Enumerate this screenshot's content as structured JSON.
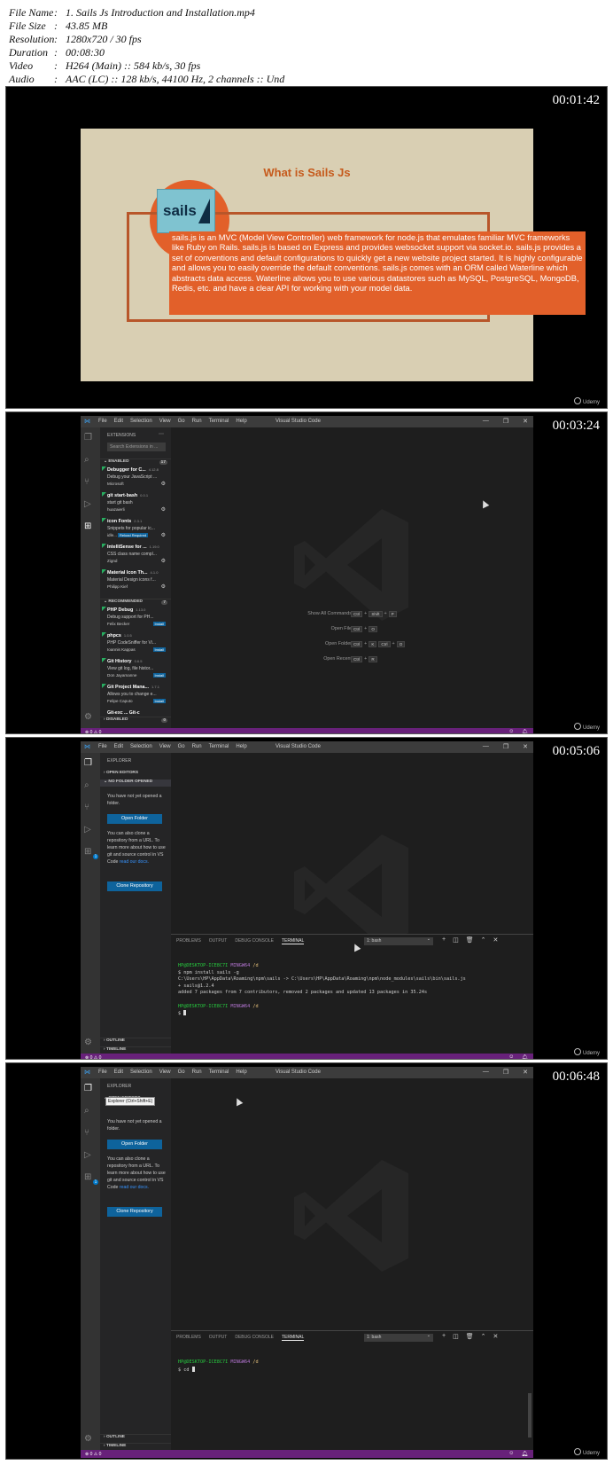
{
  "meta": [
    {
      "key": "File Name",
      "colon": ":",
      "value": "1. Sails Js Introduction and Installation.mp4"
    },
    {
      "key": "File Size",
      "colon": ":",
      "value": "43.85 MB"
    },
    {
      "key": "Resolution",
      "colon": ":",
      "value": "1280x720 / 30 fps"
    },
    {
      "key": "Duration",
      "colon": ":",
      "value": "00:08:30"
    },
    {
      "key": "Video",
      "colon": ":",
      "value": "H264 (Main) :: 584 kb/s, 30 fps"
    },
    {
      "key": "Audio",
      "colon": ":",
      "value": "AAC (LC) :: 128 kb/s, 44100 Hz, 2 channels :: Und"
    }
  ],
  "watermark": "Udemy",
  "frame1": {
    "timestamp": "00:01:42",
    "slide_title": "What is Sails Js",
    "logo_text": "sails",
    "slide_text": "sails.js is an MVC (Model View Controller) web framework for node.js that emulates familiar MVC frameworks like Ruby on Rails. sails.js is based on Express and provides websocket support via socket.io. sails.js provides a set of conventions and default configurations to quickly get a new website project started. It is highly configurable and allows you to easily override the default conventions. sails.js comes with an ORM called Waterline which abstracts data access. Waterline allows you to use various datastores such as MySQL, PostgreSQL, MongoDB, Redis, etc. and have a clear API for working with your model data."
  },
  "vscode": {
    "menu": [
      "File",
      "Edit",
      "Selection",
      "View",
      "Go",
      "Run",
      "Terminal",
      "Help"
    ],
    "title": "Visual Studio Code",
    "status_left": "⊗ 0 ⚠ 0"
  },
  "frame2": {
    "timestamp": "00:03:24",
    "sidebar_title": "EXTENSIONS",
    "search_placeholder": "Search Extensions in ...",
    "enabled_label": "ENABLED",
    "enabled_count": "17",
    "enabled": [
      {
        "name": "Debugger for C...",
        "version": "4.12.8",
        "desc": "Debug your JavaScript ...",
        "author": "Microsoft"
      },
      {
        "name": "git start-bash",
        "version": "0.0.1",
        "desc": "start git bash",
        "author": "huazaierli"
      },
      {
        "name": "icon Fonts",
        "version": "2.3.1",
        "desc": "Snippets for popular ic...",
        "author": "idle...",
        "badge": "Reload Required"
      },
      {
        "name": "IntelliSense for ...",
        "version": "1.19.0",
        "desc": "CSS class name compl...",
        "author": "Zignd"
      },
      {
        "name": "Material Icon Th...",
        "version": "4.1.0",
        "desc": "Material Design icons f...",
        "author": "Philipp Kief"
      }
    ],
    "recommended_label": "RECOMMENDED",
    "recommended_count": "7",
    "recommended": [
      {
        "name": "PHP Debug",
        "version": "1.13.0",
        "desc": "Debug support for PH...",
        "author": "Felix Becker",
        "install": "Install"
      },
      {
        "name": "phpcs",
        "version": "1.0.5",
        "desc": "PHP CodeSniffer for Vi...",
        "author": "Ioannis Kappas",
        "install": "Install"
      },
      {
        "name": "Git History",
        "version": "0.6.5",
        "desc": "View git log, file histor...",
        "author": "Don Jayamanne",
        "install": "Install"
      },
      {
        "name": "Git Project Mana...",
        "version": "1.7.1",
        "desc": "Allows you to change e...",
        "author": "Felipe Caputo",
        "install": "Install"
      }
    ],
    "cut_item": "Git-exc ... Git-c",
    "disabled_label": "DISABLED",
    "disabled_count": "0",
    "shortcuts": [
      {
        "label": "Show All Commands",
        "keys": [
          "Ctrl",
          "+",
          "Shift",
          "+",
          "P"
        ]
      },
      {
        "label": "Open File",
        "keys": [
          "Ctrl",
          "+",
          "O"
        ]
      },
      {
        "label": "Open Folder",
        "keys": [
          "Ctrl",
          "+",
          "K",
          "Ctrl",
          "+",
          "O"
        ]
      },
      {
        "label": "Open Recent",
        "keys": [
          "Ctrl",
          "+",
          "R"
        ]
      }
    ]
  },
  "explorer": {
    "title": "EXPLORER",
    "open_editors": "OPEN EDITORS",
    "no_folder": "NO FOLDER OPENED",
    "msg1": "You have not yet opened a folder.",
    "open_folder": "Open Folder",
    "msg2": "You can also clone a repository from a URL. To learn more about how to use git and source control in VS Code ",
    "msg2_link": "read our docs.",
    "clone": "Clone Repository",
    "outline": "OUTLINE",
    "timeline": "TIMELINE"
  },
  "panel": {
    "tabs": [
      "PROBLEMS",
      "OUTPUT",
      "DEBUG CONSOLE",
      "TERMINAL"
    ],
    "select": "1: bash"
  },
  "frame3": {
    "timestamp": "00:05:06",
    "prompt_user": "HP@DESKTOP-ICE8C7I",
    "prompt_env": "MINGW64",
    "prompt_dir": "/d",
    "line1": "$ npm install sails -g",
    "line2": "C:\\Users\\HP\\AppData\\Roaming\\npm\\sails -> C:\\Users\\HP\\AppData\\Roaming\\npm\\node_modules\\sails\\bin\\sails.js",
    "line3": "+ sails@1.2.4",
    "line4": "added 7 packages from 7 contributors, removed 2 packages and updated 13 packages in 35.24s",
    "prompt_end": "$ "
  },
  "frame4": {
    "timestamp": "00:06:48",
    "tooltip": "Explorer (Ctrl+Shift+E)",
    "cmd": "$ cd "
  }
}
